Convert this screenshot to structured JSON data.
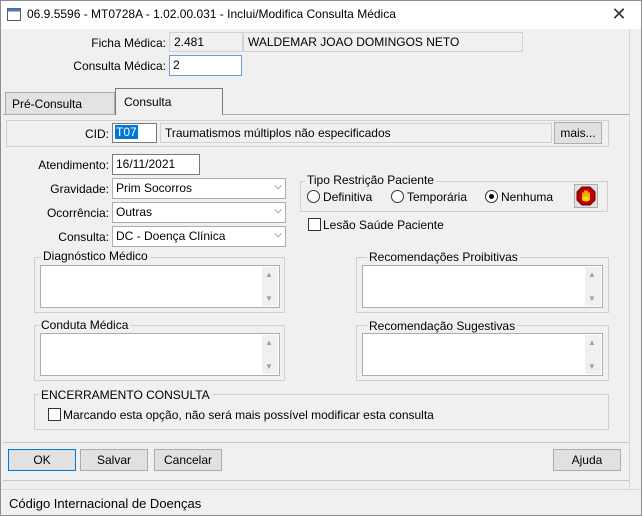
{
  "window": {
    "title": "06.9.5596 - MT0728A - 1.02.00.031 - Inclui/Modifica Consulta Médica",
    "close_glyph": "✕"
  },
  "header": {
    "ficha_label": "Ficha Médica:",
    "ficha_number": "2.481",
    "patient_name": "WALDEMAR JOAO DOMINGOS NETO",
    "consulta_label": "Consulta Médica:",
    "consulta_number": "2"
  },
  "tabs": [
    {
      "label": "Pré-Consulta",
      "active": false
    },
    {
      "label": "Consulta",
      "active": true
    }
  ],
  "cid": {
    "label": "CID:",
    "code": "T07",
    "description": "Traumatismos múltiplos não especificados",
    "more_button": "mais..."
  },
  "form": {
    "atendimento_label": "Atendimento:",
    "atendimento_value": "16/11/2021",
    "gravidade_label": "Gravidade:",
    "gravidade_value": "Prim Socorros",
    "ocorrencia_label": "Ocorrência:",
    "ocorrencia_value": "Outras",
    "consulta_label": "Consulta:",
    "consulta_value": "DC - Doença Clínica"
  },
  "restricao": {
    "title": "Tipo Restrição Paciente",
    "options": [
      "Definitiva",
      "Temporária",
      "Nenhuma"
    ],
    "selected": "Nenhuma",
    "lesao_label": "Lesão Saúde Paciente"
  },
  "textareas": {
    "diagnostico": "Diagnóstico Médico",
    "recomendacoes_proibitivas": "Recomendações Proibitivas",
    "conduta": "Conduta Médica",
    "recomendacao_sugestivas": "Recomendação Sugestivas"
  },
  "encerramento": {
    "title": "ENCERRAMENTO CONSULTA",
    "checkbox_label": "Marcando esta opção, não será mais possível modificar esta consulta"
  },
  "buttons": {
    "ok": "OK",
    "salvar": "Salvar",
    "cancelar": "Cancelar",
    "ajuda": "Ajuda"
  },
  "status": {
    "text": "Código Internacional de Doenças"
  },
  "colors": {
    "face": "#f0f0f0",
    "selection": "#0078d7",
    "stop_icon_bg": "#c00000",
    "stop_icon_fg": "#ffd800"
  }
}
